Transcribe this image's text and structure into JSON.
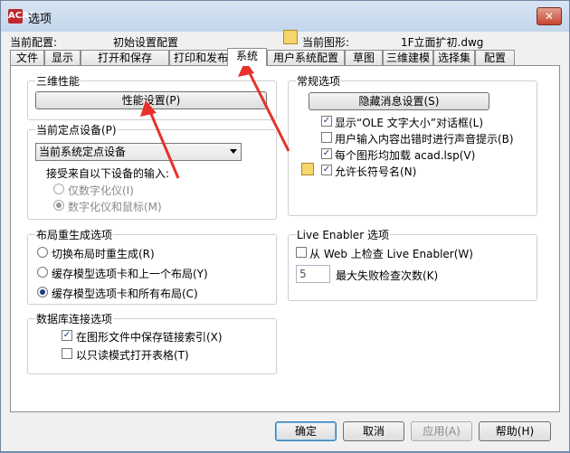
{
  "window": {
    "app_icon": "ACAD",
    "title": "选项",
    "close_glyph": "✕"
  },
  "profile": {
    "label": "当前配置:",
    "value": "初始设置配置"
  },
  "drawing": {
    "label": "当前图形:",
    "value": "1F立面扩初.dwg"
  },
  "tabs": [
    "文件",
    "显示",
    "打开和保存",
    "打印和发布",
    "系统",
    "用户系统配置",
    "草图",
    "三维建模",
    "选择集",
    "配置"
  ],
  "active_tab": "系统",
  "perf": {
    "title": "三维性能",
    "button": "性能设置(P)"
  },
  "pointing": {
    "title": "当前定点设备(P)",
    "select_value": "当前系统定点设备",
    "accept_label": "接受来自以下设备的输入:",
    "options": [
      "仅数字化仪(I)",
      "数字化仪和鼠标(M)"
    ]
  },
  "layout_regen": {
    "title": "布局重生成选项",
    "options": [
      "切换布局时重生成(R)",
      "缓存模型选项卡和上一个布局(Y)",
      "缓存模型选项卡和所有布局(C)"
    ]
  },
  "db": {
    "title": "数据库连接选项",
    "options": [
      "在图形文件中保存链接索引(X)",
      "以只读模式打开表格(T)"
    ]
  },
  "general": {
    "title": "常规选项",
    "button": "隐藏消息设置(S)",
    "options": [
      "显示“OLE 文字大小”对话框(L)",
      "用户输入内容出错时进行声音提示(B)",
      "每个图形均加载 acad.lsp(V)",
      "允许长符号名(N)"
    ]
  },
  "live": {
    "title": "Live Enabler 选项",
    "check_web": "从 Web 上检查 Live Enabler(W)",
    "max_value": "5",
    "max_label": "最大失败检查次数(K)"
  },
  "footer": {
    "ok": "确定",
    "cancel": "取消",
    "apply": "应用(A)",
    "help": "帮助(H)"
  },
  "colors": {
    "annotation_arrow": "#e8312a"
  },
  "icons": [
    "app-icon",
    "drawing-file-icon",
    "long-names-icon",
    "close-icon",
    "dropdown-arrow-icon"
  ]
}
